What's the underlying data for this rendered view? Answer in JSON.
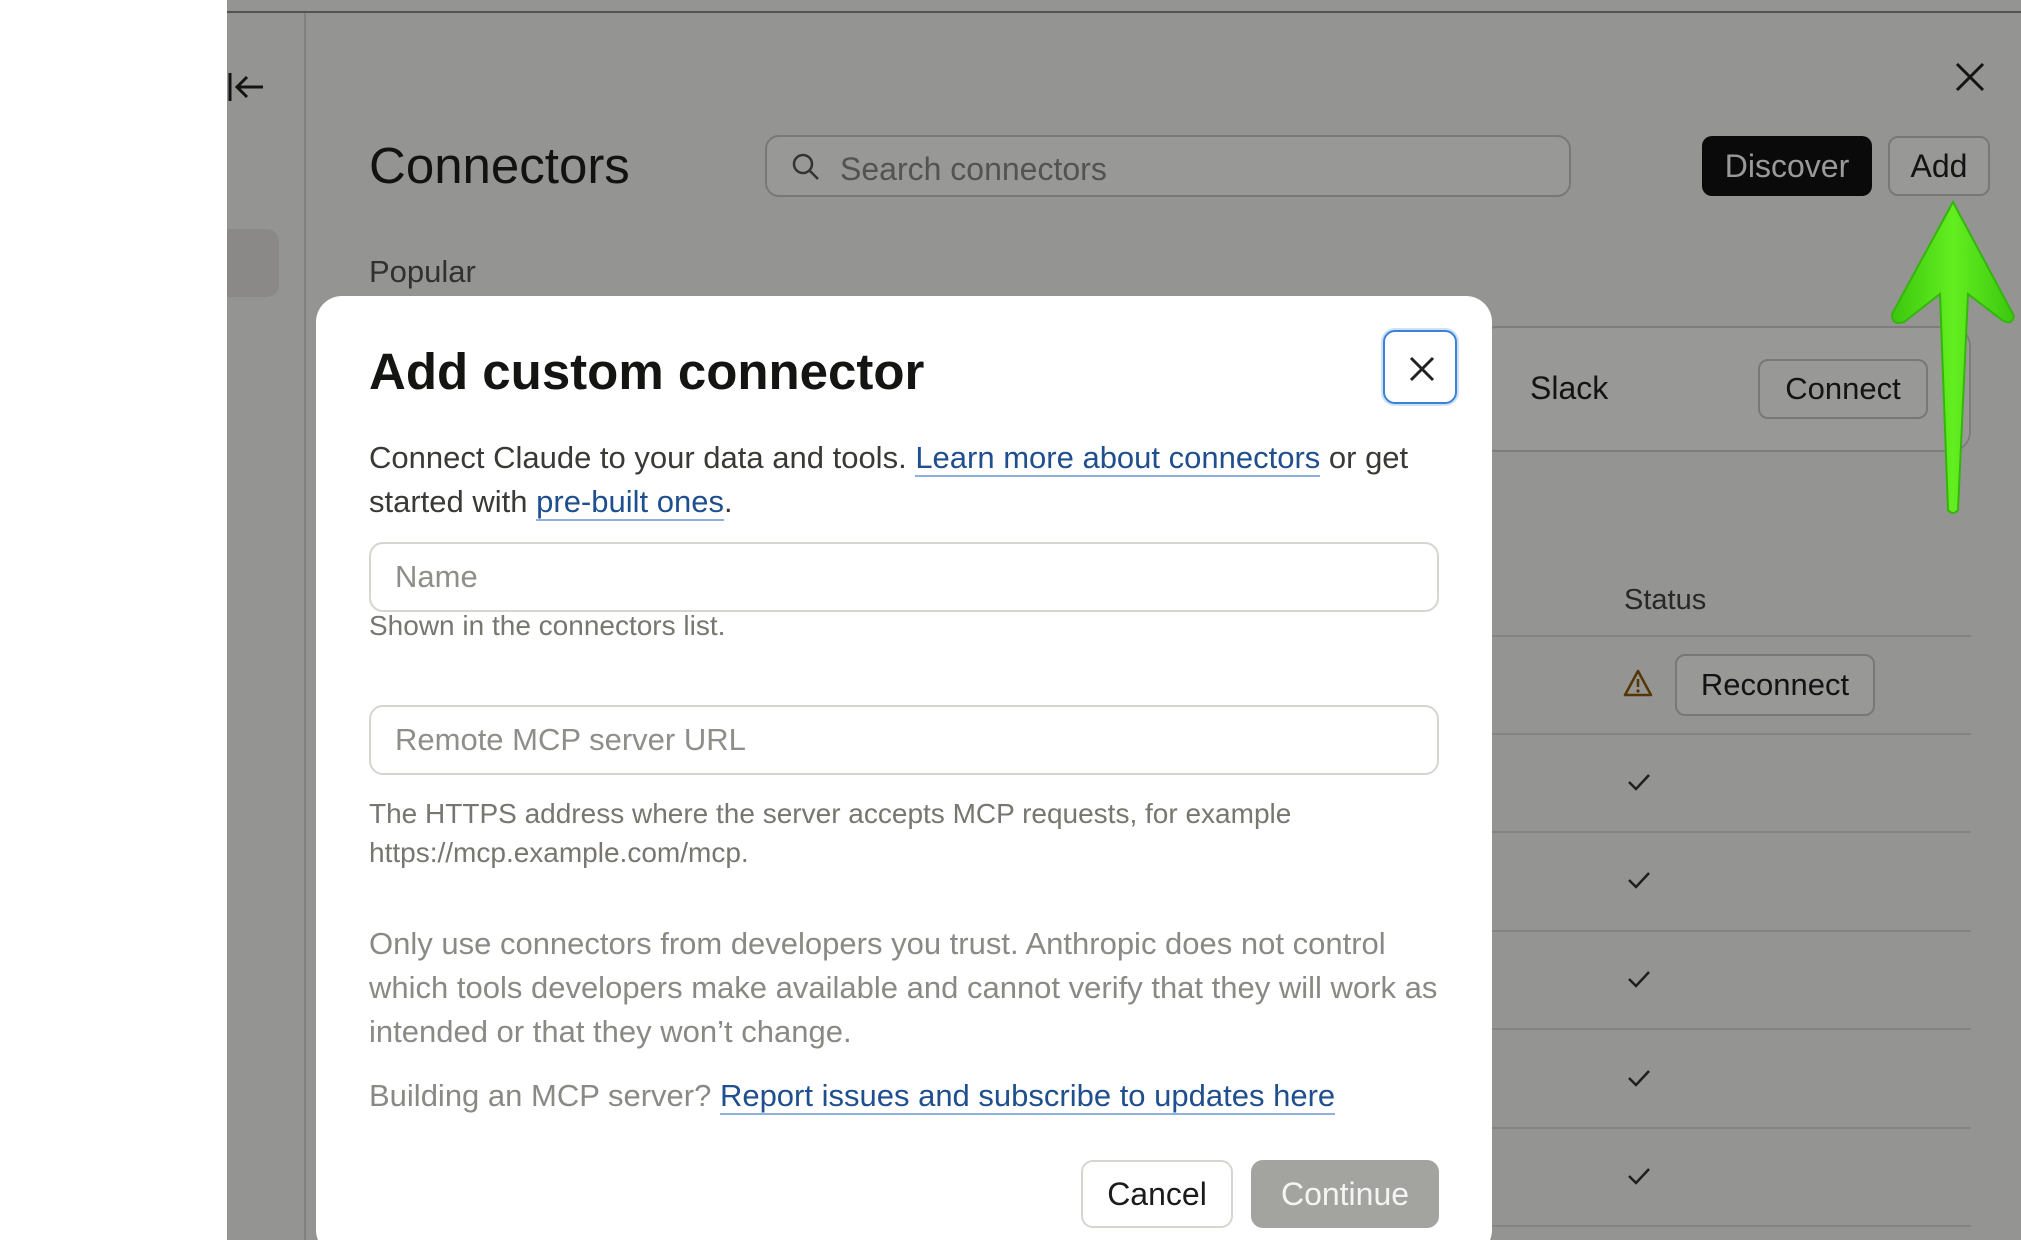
{
  "connectors_page": {
    "title": "Connectors",
    "search_placeholder": "Search connectors",
    "discover_label": "Discover",
    "add_label": "Add",
    "popular_label": "Popular",
    "slack": {
      "name": "Slack",
      "connect_label": "Connect"
    },
    "status_header": "Status",
    "reconnect_label": "Reconnect"
  },
  "modal": {
    "title": "Add custom connector",
    "desc_text_1": "Connect Claude to your data and tools. ",
    "desc_link_1": "Learn more about connectors",
    "desc_text_2": " or get started with ",
    "desc_link_2": "pre-built ones",
    "desc_text_3": ".",
    "name_placeholder": "Name",
    "name_hint": "Shown in the connectors list.",
    "url_placeholder": "Remote MCP server URL",
    "url_hint": "The HTTPS address where the server accepts MCP requests, for example https://mcp.example.com/mcp.",
    "warning": "Only use connectors from developers you trust. Anthropic does not control which tools developers make available and cannot verify that they will work as intended or that they won’t change.",
    "building_text": "Building an MCP server? ",
    "building_link": "Report issues and subscribe to updates here",
    "cancel_label": "Cancel",
    "continue_label": "Continue"
  },
  "icons": {
    "sidebar_toggle": "collapse-sidebar-icon",
    "panel_close": "close-icon",
    "search": "search-icon",
    "warning": "warning-icon",
    "check": "check-icon",
    "annotation": "arrow-up-annotation"
  },
  "colors": {
    "primary_button": "#111111",
    "link": "#1f4f8f",
    "focus_ring": "#3b82d6",
    "annotation_arrow": "#4ddc16"
  }
}
